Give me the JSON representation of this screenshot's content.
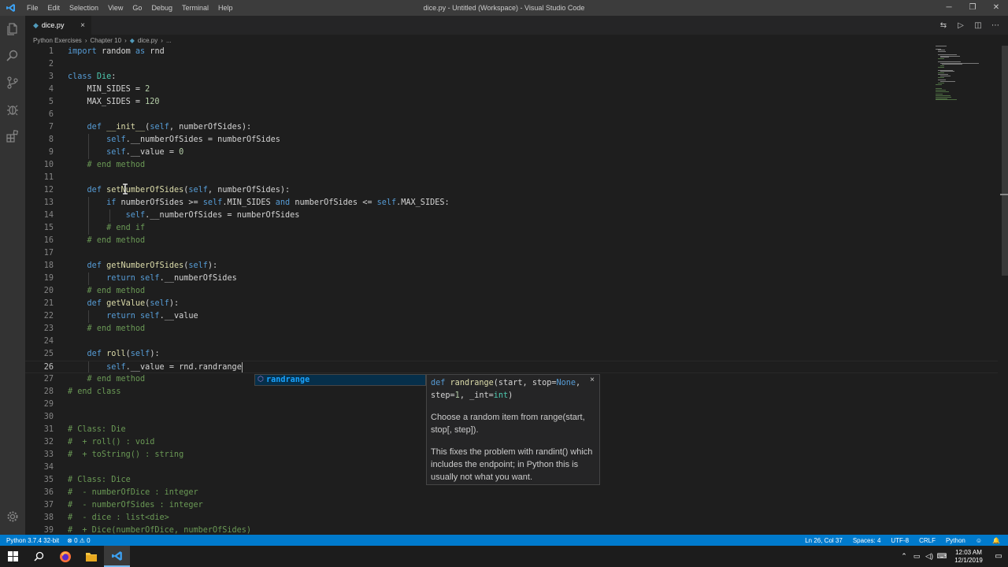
{
  "titlebar": {
    "menu": [
      "File",
      "Edit",
      "Selection",
      "View",
      "Go",
      "Debug",
      "Terminal",
      "Help"
    ],
    "title": "dice.py - Untitled (Workspace) - Visual Studio Code",
    "minimize": "─",
    "maximize": "❐",
    "close": "✕"
  },
  "tab": {
    "label": "dice.py",
    "close": "×"
  },
  "breadcrumb": {
    "folder1": "Python Exercises",
    "sep1": "›",
    "folder2": "Chapter 10",
    "sep2": "›",
    "file": "dice.py",
    "sep3": "›",
    "more": "..."
  },
  "editor": {
    "current_line": 26,
    "lines": [
      "import random as rnd",
      "",
      "class Die:",
      "    MIN_SIDES = 2",
      "    MAX_SIDES = 120",
      "",
      "    def __init__(self, numberOfSides):",
      "        self.__numberOfSides = numberOfSides",
      "        self.__value = 0",
      "    # end method",
      "",
      "    def setNumberOfSides(self, numberOfSides):",
      "        if numberOfSides >= self.MIN_SIDES and numberOfSides <= self.MAX_SIDES:",
      "            self.__numberOfSides = numberOfSides",
      "        # end if",
      "    # end method",
      "",
      "    def getNumberOfSides(self):",
      "        return self.__numberOfSides",
      "    # end method",
      "    def getValue(self):",
      "        return self.__value",
      "    # end method",
      "",
      "    def roll(self):",
      "        self.__value = rnd.randrange",
      "    # end method",
      "# end class",
      "",
      "",
      "# Class: Die",
      "#  + roll() : void",
      "#  + toString() : string",
      "",
      "# Class: Dice",
      "#  - numberOfDice : integer",
      "#  - numberOfSides : integer",
      "#  - dice : list<die>",
      "#  + Dice(numberOfDice, numberOfSides)"
    ]
  },
  "suggest": {
    "icon": "⬡",
    "label": "randrange"
  },
  "details": {
    "sig_kw": "def",
    "sig_fn": "randrange",
    "sig_args1": "(start, stop=",
    "sig_none": "None",
    "sig_args2": ",",
    "sig_args3": "step=",
    "sig_one": "1",
    "sig_args4": ", _int=",
    "sig_int": "int",
    "sig_args5": ")",
    "close": "×",
    "para1": "Choose a random item from range(start, stop[, step]).",
    "para2": "This fixes the problem with randint() which includes the endpoint; in Python this is usually not what you want."
  },
  "statusbar": {
    "interpreter": "Python 3.7.4 32-bit",
    "problems": "⊗ 0 ⚠ 0",
    "position": "Ln 26, Col 37",
    "spaces": "Spaces: 4",
    "encoding": "UTF-8",
    "eol": "CRLF",
    "language": "Python",
    "feedback": "☺",
    "bell": "🔔"
  },
  "taskbar": {
    "time": "12:03 AM",
    "date": "12/1/2019"
  },
  "colors": {
    "accent": "#007acc",
    "editor_bg": "#1e1e1e",
    "keyword": "#569cd6",
    "class": "#4ec9b0",
    "function": "#dcdcaa",
    "number": "#b5cea8",
    "comment": "#6a9955"
  }
}
